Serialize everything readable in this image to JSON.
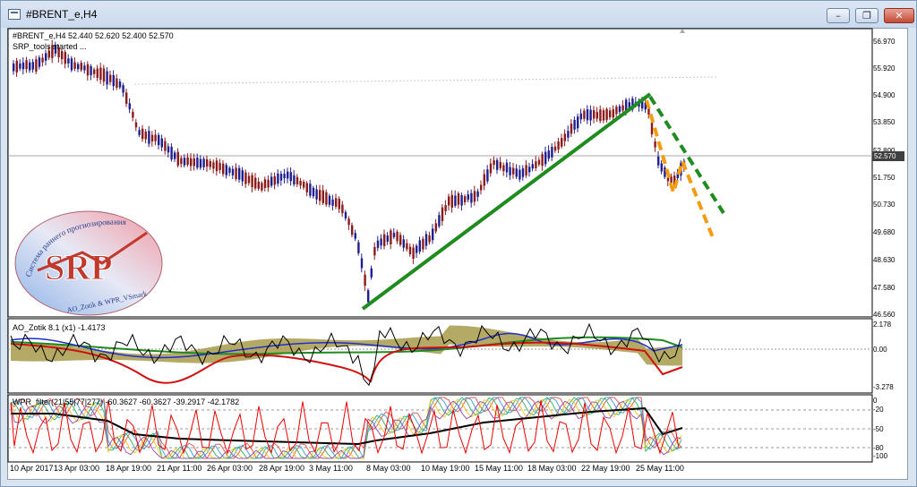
{
  "window": {
    "title": "#BRENT_e,H4",
    "buttons": {
      "minimize": "–",
      "restore": "❐",
      "close": "✕"
    }
  },
  "chart": {
    "header": "#BRENT_e,H4  52.440 52.620 52.400 52.570",
    "status": "SRP_tools started ...",
    "price_axis": [
      "56.970",
      "55.920",
      "54.900",
      "53.850",
      "52.800",
      "51.750",
      "50.730",
      "49.680",
      "48.630",
      "47.580",
      "46.560"
    ],
    "current_price": "52.570",
    "time_axis": [
      "10 Apr 2017",
      "13 Apr 03:00",
      "18 Apr 19:00",
      "21 Apr 11:00",
      "26 Apr 03:00",
      "28 Apr 19:00",
      "3 May 11:00",
      "8 May 03:00",
      "10 May 19:00",
      "15 May 11:00",
      "18 May 03:00",
      "22 May 19:00",
      "25 May 11:00"
    ],
    "colors": {
      "bull": "#1f1f8f",
      "bear": "#8b1a1a",
      "trend": "#1e8c1e",
      "forecast": "#f39c12"
    }
  },
  "ao_panel": {
    "label": "AO_Zotik 8.1 (x1) -1.4173",
    "axis": [
      "2.178",
      "0.00",
      "-3.278"
    ]
  },
  "wpr_panel": {
    "label": "WPR_filter(21|55|77|277)  -60.3627 -60.3627 -39.2917 -42.1782",
    "axis": [
      "0",
      "-20",
      "-50",
      "-80",
      "-100"
    ]
  },
  "logo": {
    "letters": "SRP",
    "arc_text": "Система раннего прогнозирования",
    "bottom_text": "AO_Zotik & WPR_VSmark"
  }
}
